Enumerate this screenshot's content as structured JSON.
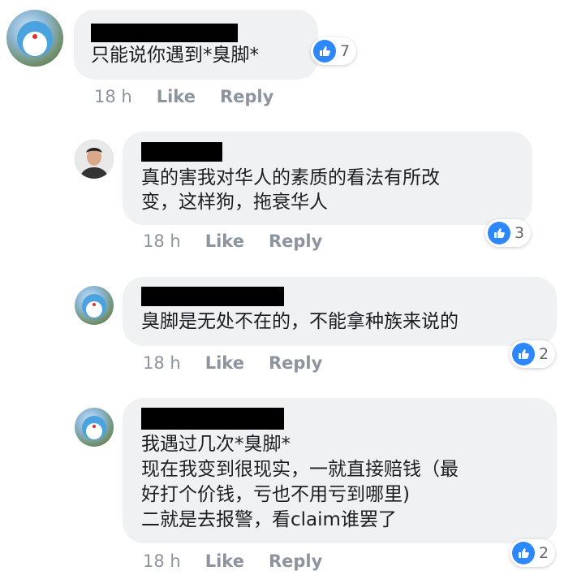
{
  "comments": [
    {
      "avatar_kind": "cartoon",
      "text_lines": [
        "只能说你遇到*臭脚*"
      ],
      "reactions": "7",
      "time": "18 h",
      "like": "Like",
      "reply": "Reply"
    },
    {
      "avatar_kind": "person",
      "text_lines": [
        "真的害我对华人的素质的看法有所改",
        "变，这样狗，拖衰华人"
      ],
      "reactions": "3",
      "time": "18 h",
      "like": "Like",
      "reply": "Reply"
    },
    {
      "avatar_kind": "cartoon",
      "text_lines": [
        "臭脚是无处不在的，不能拿种族来说的"
      ],
      "reactions": "2",
      "time": "18 h",
      "like": "Like",
      "reply": "Reply"
    },
    {
      "avatar_kind": "cartoon",
      "text_lines": [
        "我遇过几次*臭脚*",
        "现在我变到很现实，一就直接赔钱（最",
        "好打个价钱，亏也不用亏到哪里)",
        "二就是去报警，看claim谁罢了"
      ],
      "reactions": "2",
      "time": "18 h",
      "like": "Like",
      "reply": "Reply"
    }
  ],
  "colors": {
    "like_blue": "#2d88ff",
    "bubble": "#f0f1f3",
    "meta": "#8d949e"
  },
  "icons": {
    "reaction": "thumbs-up-icon"
  }
}
